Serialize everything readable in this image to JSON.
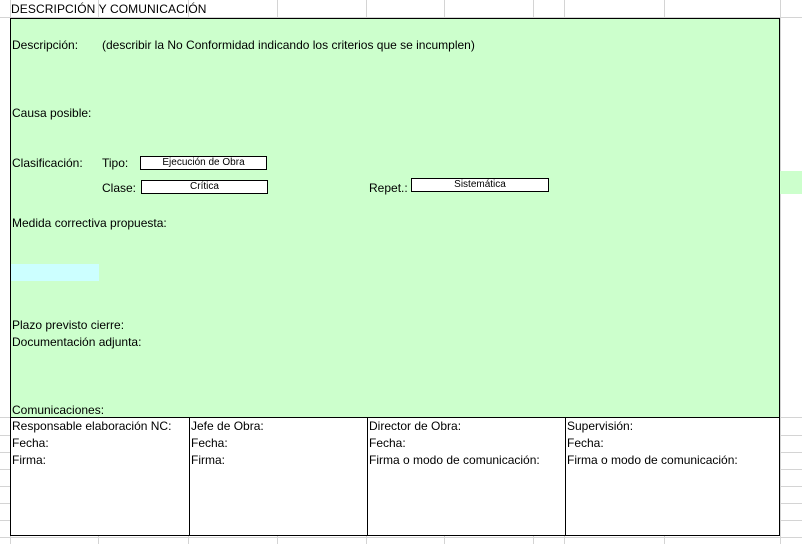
{
  "section_title": "DESCRIPCIÓN Y COMUNICACIÓN",
  "descripcion": {
    "label": "Descripción:",
    "hint": "(describir la No Conformidad indicando los criterios que se incumplen)"
  },
  "causa_label": "Causa posible:",
  "clasificacion": {
    "label": "Clasificación:",
    "tipo_label": "Tipo:",
    "tipo_value": "Ejecución de Obra",
    "clase_label": "Clase:",
    "clase_value": "Crítica",
    "repet_label": "Repet.:",
    "repet_value": "Sistemática"
  },
  "medida_label": "Medida correctiva propuesta:",
  "plazo_label": "Plazo previsto cierre:",
  "documentacion_label": "Documentación adjunta:",
  "comunicaciones_label": "Comunicaciones:",
  "signatures": [
    {
      "role": "Responsable elaboración NC:",
      "fecha": "Fecha:",
      "firma": "Firma:"
    },
    {
      "role": "Jefe de Obra:",
      "fecha": "Fecha:",
      "firma": "Firma:"
    },
    {
      "role": "Director de Obra:",
      "fecha": "Fecha:",
      "firma": "Firma o modo de comunicación:"
    },
    {
      "role": "Supervisión:",
      "fecha": "Fecha:",
      "firma": "Firma o modo de comunicación:"
    }
  ],
  "colors": {
    "panel_green": "#ccffcc",
    "highlight_cyan": "#ccffff",
    "grid_line": "#d4d4d4"
  }
}
